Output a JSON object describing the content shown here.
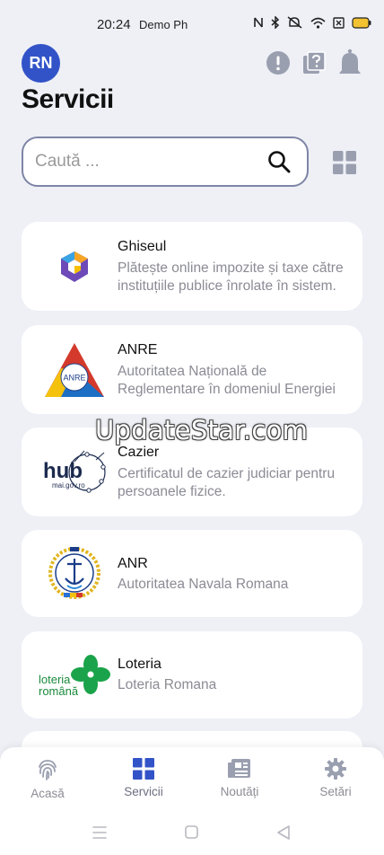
{
  "status_bar": {
    "time": "20:24",
    "carrier": "Demo Ph"
  },
  "header": {
    "avatar_initials": "RN",
    "title": "Servicii"
  },
  "search": {
    "placeholder": "Caută ..."
  },
  "services": [
    {
      "title": "Ghiseul",
      "description": "Plătește online impozite și taxe către instituțiile publice înrolate în sistem.",
      "logo": "ghiseul-logo"
    },
    {
      "title": "ANRE",
      "description": "Autoritatea Națională de Reglementare în domeniul Energiei",
      "logo": "anre-logo",
      "logo_text": "ANRE"
    },
    {
      "title": "Cazier",
      "description": "Certificatul de cazier judiciar pentru persoanele fizice.",
      "logo": "hub-mai-logo",
      "logo_text": "hub",
      "logo_subtext": "mai.gov.ro"
    },
    {
      "title": "ANR",
      "description": "Autoritatea Navala Romana",
      "logo": "anr-emblem"
    },
    {
      "title": "Loteria",
      "description": "Loteria Romana",
      "logo": "loteria-logo",
      "logo_text": "loteria",
      "logo_subtext": "română"
    }
  ],
  "watermark": "UpdateStar.com",
  "bottom_nav": [
    {
      "label": "Acasă",
      "icon": "fingerprint-icon",
      "active": false
    },
    {
      "label": "Servicii",
      "icon": "grid-icon",
      "active": true
    },
    {
      "label": "Noutăți",
      "icon": "newspaper-icon",
      "active": false
    },
    {
      "label": "Setări",
      "icon": "gear-icon",
      "active": false
    }
  ],
  "colors": {
    "accent": "#3253c8",
    "background": "#eef0f6",
    "icon_gray": "#9a9fb0"
  }
}
